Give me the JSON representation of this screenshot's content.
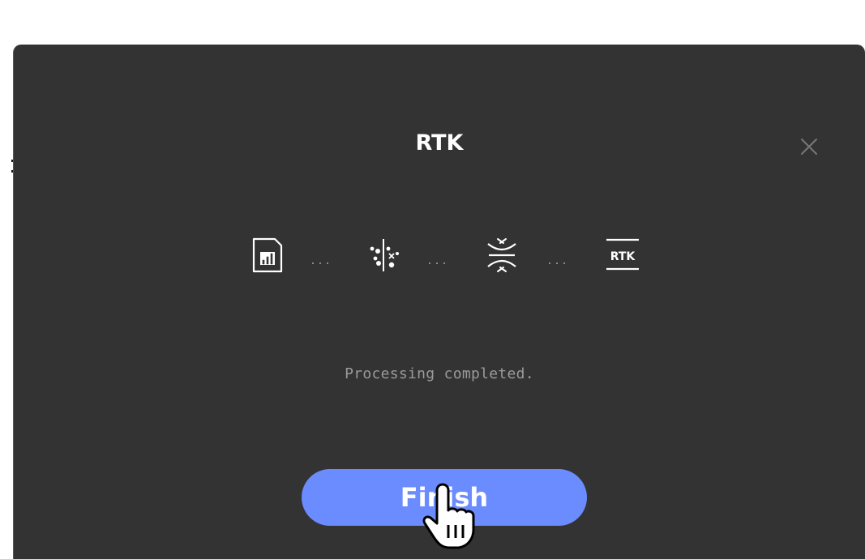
{
  "dialog": {
    "title": "RTK",
    "close_icon": "close-icon",
    "status": "Processing completed.",
    "finish_label": "Finish"
  },
  "steps": [
    {
      "icon": "file-chart-icon"
    },
    {
      "icon": "point-split-icon"
    },
    {
      "icon": "converge-icon"
    },
    {
      "icon": "rtk-icon",
      "label": "RTK"
    }
  ],
  "colors": {
    "dialog_bg": "#333333",
    "accent": "#6b8cff",
    "text_primary": "#ffffff",
    "text_secondary": "#9a9a9a"
  },
  "cursor": "hand-pointer-icon"
}
